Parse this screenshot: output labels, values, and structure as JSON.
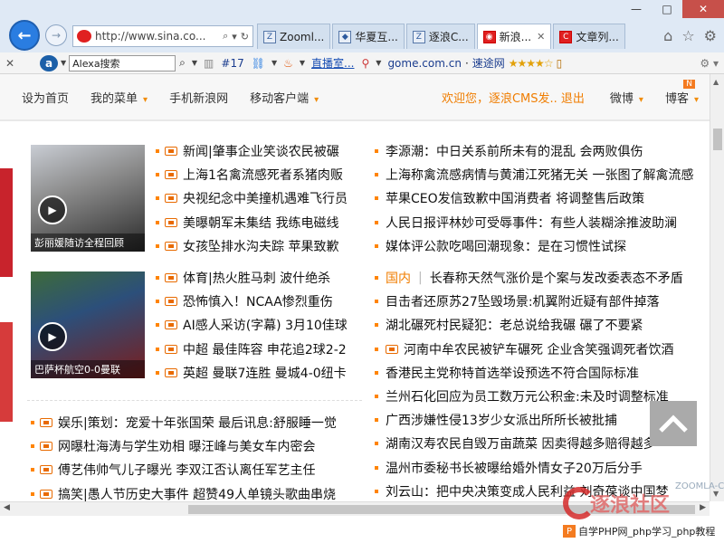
{
  "browser": {
    "address": "http://www.sina.co...",
    "tabs": [
      {
        "label": "Zooml...",
        "icon": "z-icon"
      },
      {
        "label": "华夏互...",
        "icon": "diamond-icon"
      },
      {
        "label": "逐浪C...",
        "icon": "z-icon"
      },
      {
        "label": "新浪...",
        "icon": "sina-icon",
        "active": true
      },
      {
        "label": "文章列...",
        "icon": "c-icon"
      }
    ],
    "window_buttons": [
      "—",
      "□",
      "✕"
    ]
  },
  "toolbar": {
    "alexa_placeholder": "Alexa搜索",
    "rank": "#17",
    "zhibo": "直播室...",
    "domain": "gome.com.cn",
    "domain_sep": "·",
    "domain_name": "速途网",
    "stars": "★★★★☆"
  },
  "sitenav": {
    "items": [
      {
        "label": "设为首页",
        "caret": false
      },
      {
        "label": "我的菜单",
        "caret": true
      },
      {
        "label": "手机新浪网",
        "caret": false
      },
      {
        "label": "移动客户端",
        "caret": true
      }
    ],
    "welcome": "欢迎您，逐浪CMS发.. 退出",
    "right_items": [
      {
        "label": "微博",
        "caret": true
      },
      {
        "label": "博客",
        "caret": true
      }
    ],
    "badge": "N"
  },
  "thumbs": [
    {
      "caption": "彭丽媛随访全程回顾"
    },
    {
      "caption": "巴萨杯航空0-0曼联"
    }
  ],
  "left_news_1": [
    "新闻|肇事企业笑谈农民被碾",
    "上海1名禽流感死者系猪肉贩",
    "央视纪念中美撞机遇难飞行员",
    "美曝朝军未集结 我练电磁线",
    "女孩坠排水沟夫踪 苹果致歉"
  ],
  "left_news_2": [
    "体育|热火胜马刺 波什绝杀",
    "恐怖慎入！NCAA惨烈重伤",
    "AI感人采访(字幕) 3月10佳球",
    "中超 最佳阵容 申花追2球2-2",
    "英超 曼联7连胜 曼城4-0纽卡"
  ],
  "right_news_1": [
    "李源潮：中日关系前所未有的混乱 会两败俱伤",
    "上海称禽流感病情与黄浦江死猪无关 一张图了解禽流感",
    "苹果CEO发信致歉中国消费者 将调整售后政策",
    "人民日报评林妙可受辱事件：有些人装糊涂推波助澜",
    "媒体评公款吃喝回潮现象：是在习惯性试探"
  ],
  "right_news_2": [
    {
      "tag": "国内",
      "text": "长春称天然气涨价是个案与发改委表态不矛盾"
    },
    {
      "tag": "",
      "text": "目击者还原苏27坠毁场景:机翼附近疑有部件掉落"
    },
    {
      "tag": "",
      "text": "湖北碾死村民疑犯：老总说给我碾 碾了不要紧"
    },
    {
      "tag": "",
      "text": "河南中牟农民被铲车碾死 企业含笑强调死者饮酒"
    },
    {
      "tag": "",
      "text": "香港民主党称特首选举设预选不符合国际标准"
    },
    {
      "tag": "",
      "text": "兰州石化回应为员工数万元公积金:未及时调整标准"
    },
    {
      "tag": "",
      "text": "广西涉嫌性侵13岁少女派出所所长被批捕"
    },
    {
      "tag": "",
      "text": "湖南汉寿农民自毁万亩蔬菜 因卖得越多赔得越多"
    },
    {
      "tag": "",
      "text": "温州市委秘书长被曝给婚外情女子20万后分手"
    },
    {
      "tag": "",
      "text": "刘云山：把中央决策变成人民利益 刘奇葆谈中国梦"
    }
  ],
  "left_news_3": [
    "娱乐|策划：宠爱十年张国荣 最后讯息:舒服睡一觉",
    "网曝杜海涛与学生劝相 曝汪峰与美女车内密会",
    "傅艺伟帅气儿子曝光 李双江否认离任军艺主任",
    "搞笑|愚人节历史大事件 超赞49人单镜头歌曲串烧"
  ],
  "watermark": {
    "brand": "逐浪社区",
    "cms": "ZOOMLA-CMS",
    "site": "自学PHP网_php学习_php教程"
  }
}
